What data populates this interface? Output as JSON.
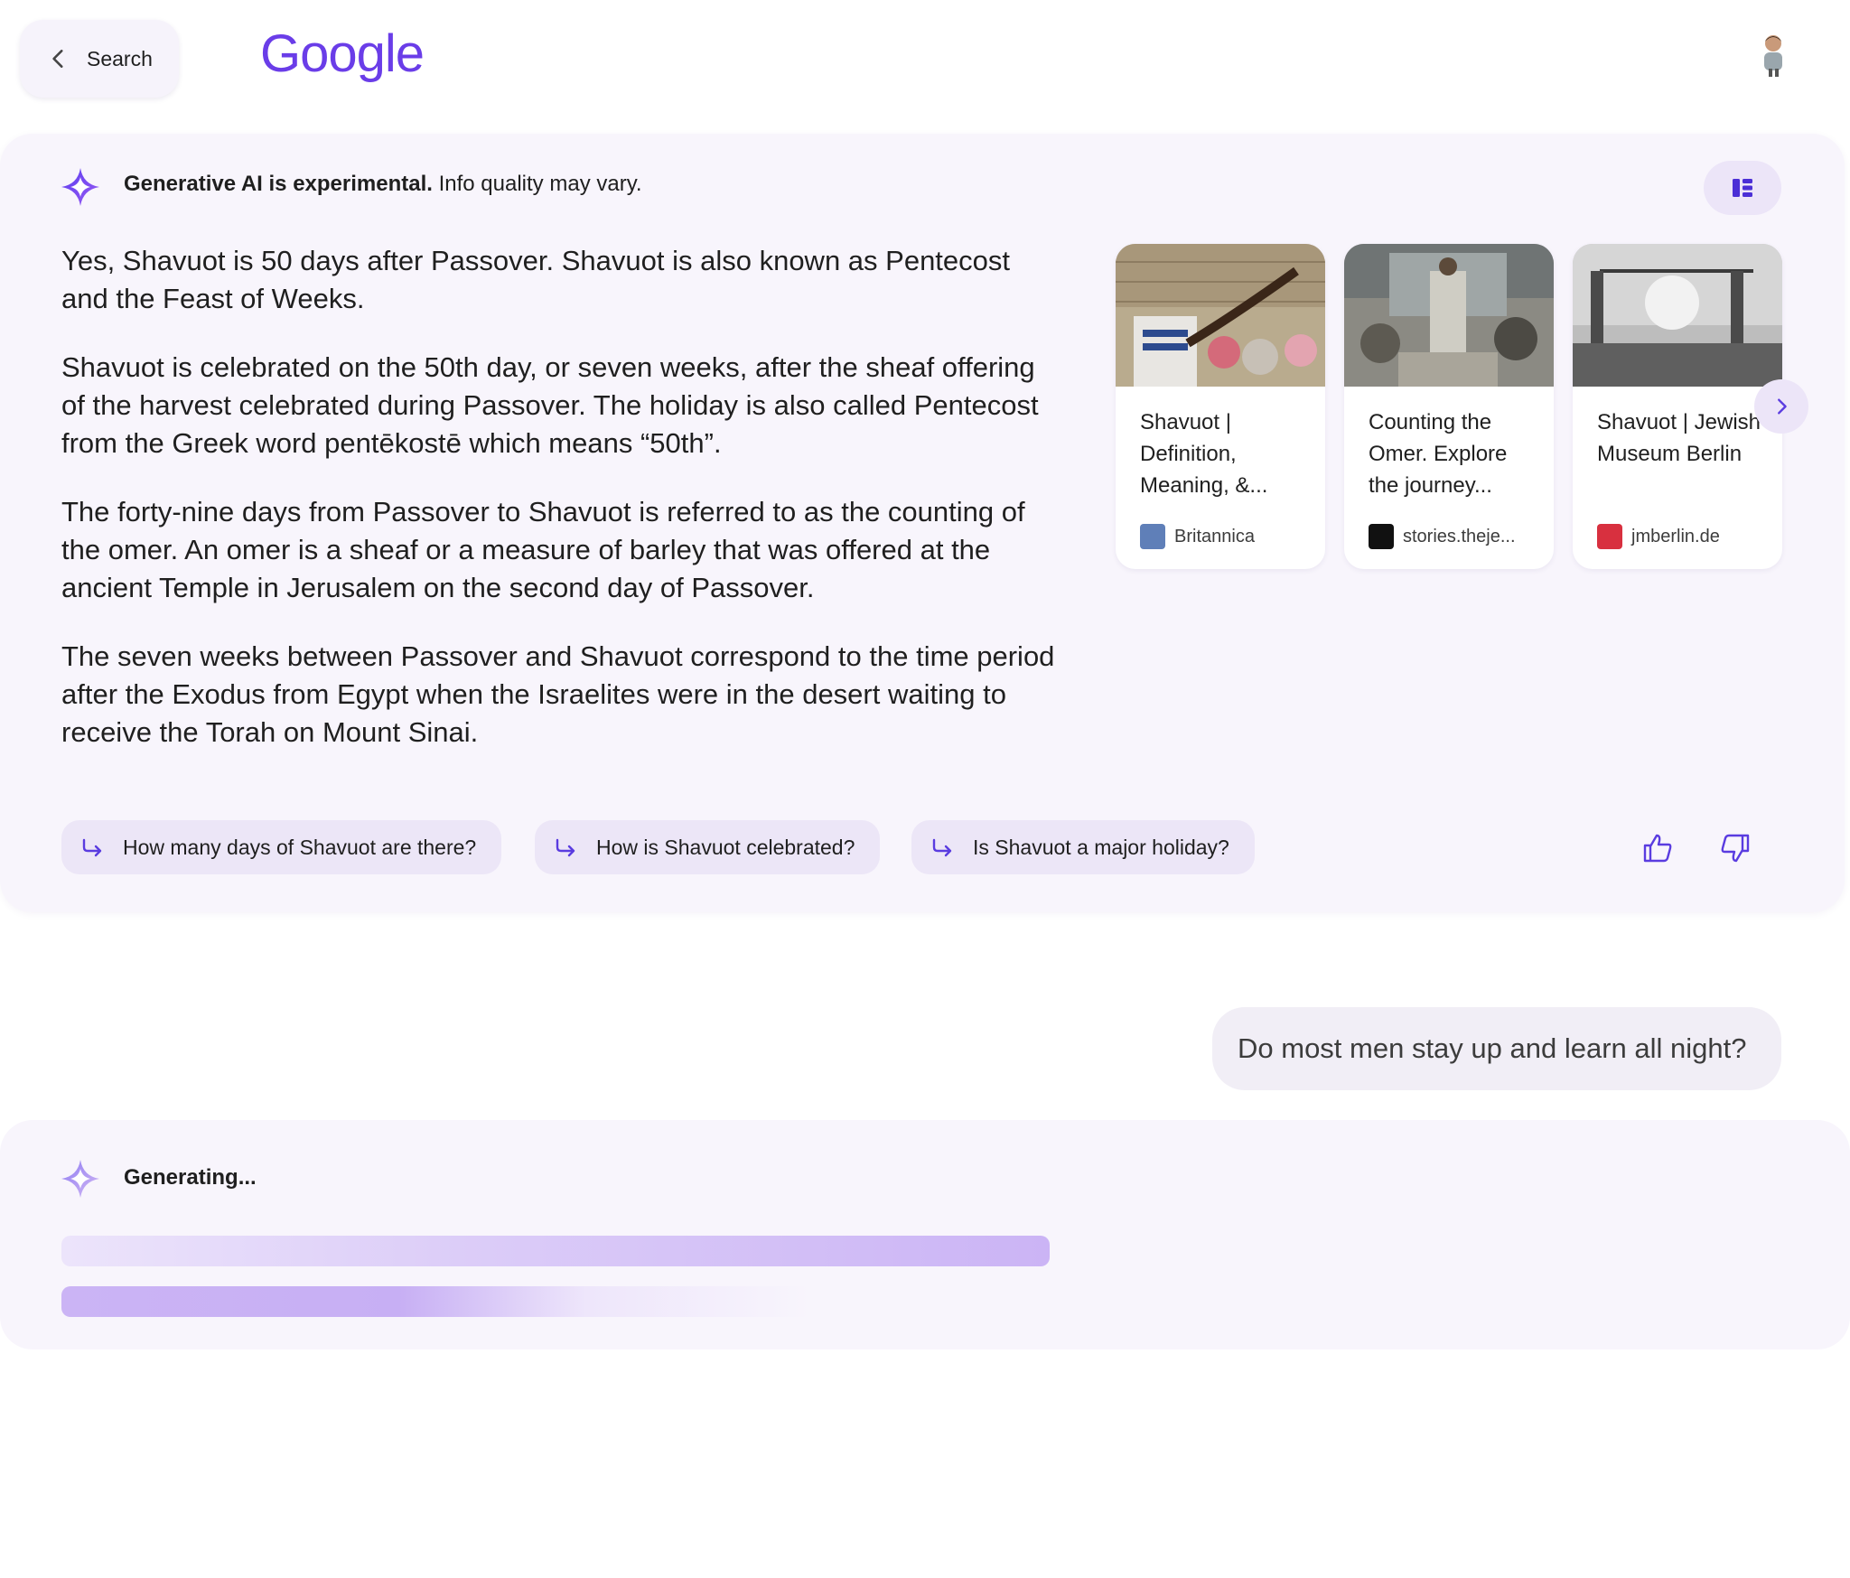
{
  "header": {
    "back_label": "Search",
    "logo": "Google"
  },
  "ai_overview": {
    "notice_bold": "Generative AI is experimental.",
    "notice_rest": " Info quality may vary.",
    "paragraphs": [
      "Yes, Shavuot is 50 days after Passover. Shavuot is also known as Pentecost and the Feast of Weeks.",
      "Shavuot is celebrated on the 50th day, or seven weeks, after the sheaf offering of the harvest celebrated during Passover. The holiday is also called Pentecost from the Greek word pentēkostē which means “50th”.",
      "The forty-nine days from Passover to Shavuot is referred to as the counting of the omer. An omer is a sheaf or a measure of barley that was offered at the ancient Temple in Jerusalem on the second day of Passover.",
      "The seven weeks between Passover and Shavuot correspond to the time period after the Exodus from Egypt when the Israelites were in the desert waiting to receive the Torah on Mount Sinai."
    ],
    "sources": [
      {
        "title": "Shavuot | Definition, Meaning, &...",
        "site": "Britannica",
        "favicon_color": "#5f7fb8"
      },
      {
        "title": "Counting the Omer. Explore the journey...",
        "site": "stories.theje...",
        "favicon_color": "#111111"
      },
      {
        "title": "Shavuot | Jewish Museum Berlin",
        "site": "jmberlin.de",
        "favicon_color": "#d8303f"
      }
    ],
    "followups": [
      "How many days of Shavuot are there?",
      "How is Shavuot celebrated?",
      "Is Shavuot a major holiday?"
    ]
  },
  "conversation": {
    "user_message": "Do most men stay up and learn all night?",
    "generating_label": "Generating..."
  },
  "colors": {
    "accent": "#6a3de8",
    "card_bg": "#f8f5fc",
    "chip_bg": "#ece6f7"
  }
}
